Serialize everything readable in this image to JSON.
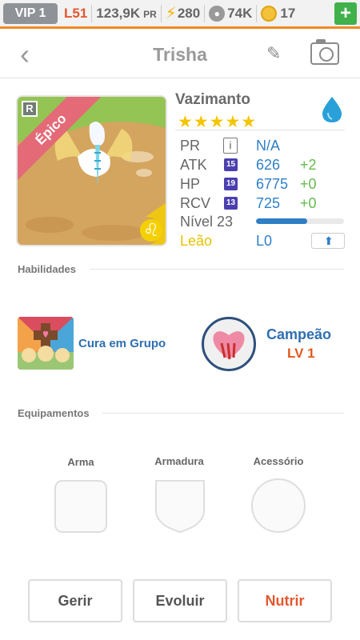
{
  "status_bar": {
    "vip": "VIP 1",
    "level": "L51",
    "pr_value": "123,9K",
    "pr_unit": "PR",
    "energy": "280",
    "paws": "74K",
    "coins": "17",
    "add_label": "+"
  },
  "header": {
    "title": "Trisha"
  },
  "monster": {
    "rarity": "Épico",
    "rarity_badge": "R",
    "zodiac_symbol": "♌",
    "name": "Vazimanto",
    "stars": "★★★★★",
    "element": "water-drop-icon"
  },
  "stats": [
    {
      "label": "PR",
      "badge": "i",
      "value": "N/A",
      "bonus": ""
    },
    {
      "label": "ATK",
      "badge": "15",
      "value": "626",
      "bonus": "+2"
    },
    {
      "label": "HP",
      "badge": "19",
      "value": "6775",
      "bonus": "+0"
    },
    {
      "label": "RCV",
      "badge": "13",
      "value": "725",
      "bonus": "+0"
    }
  ],
  "level": {
    "label": "Nível 23",
    "progress": 0.58
  },
  "sign": {
    "label": "Leão",
    "value": "L0"
  },
  "abilities": {
    "title": "Habilidades",
    "skill1": {
      "name": "Cura em Grupo"
    },
    "skill2": {
      "name": "Campeão",
      "level": "LV 1"
    }
  },
  "equipment": {
    "title": "Equipamentos",
    "slots": [
      {
        "label": "Arma"
      },
      {
        "label": "Armadura"
      },
      {
        "label": "Acessório"
      }
    ]
  },
  "actions": {
    "manage": "Gerir",
    "evolve": "Evoluir",
    "feed": "Nutrir"
  },
  "colors": {
    "accent_orange": "#f08a24",
    "stat_blue": "#2f80c8",
    "bonus_green": "#65bb4d",
    "star_gold": "#f5c400",
    "feed_red": "#e4572e"
  }
}
